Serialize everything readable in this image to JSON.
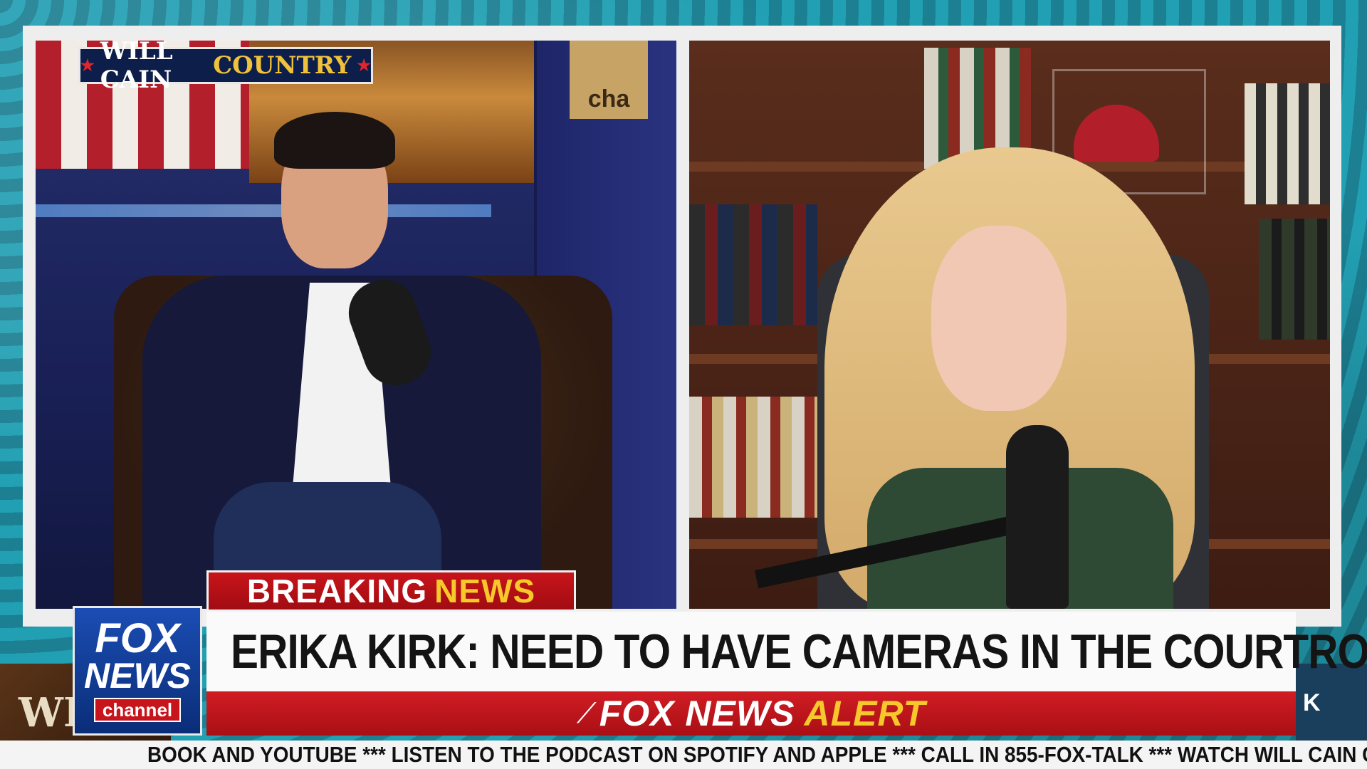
{
  "show_logo": {
    "will_cain": "WILL CAIN",
    "country": "COUNTRY"
  },
  "door_sign": "cha",
  "lower_third": {
    "breaking_word1": "BREAKING",
    "breaking_word2": "NEWS",
    "headline": "ERIKA KIRK: NEED TO HAVE CAMERAS IN THE COURTROOM",
    "alert_word1": "FOX NEWS",
    "alert_word2": "ALERT"
  },
  "network_logo": {
    "line1": "FOX",
    "line2": "NEWS",
    "line3": "channel"
  },
  "mini_logo_text": "WIL",
  "right_stub_text": "K",
  "ticker": "BOOK AND YOUTUBE  ***  LISTEN TO THE PODCAST ON SPOTIFY AND APPLE  ***  CALL IN 855-FOX-TALK  ***  WATCH WILL CAIN COUNTRY",
  "colors": {
    "brand_blue": "#0a2d78",
    "alert_red": "#c8141b",
    "accent_yellow": "#f6c82b"
  }
}
